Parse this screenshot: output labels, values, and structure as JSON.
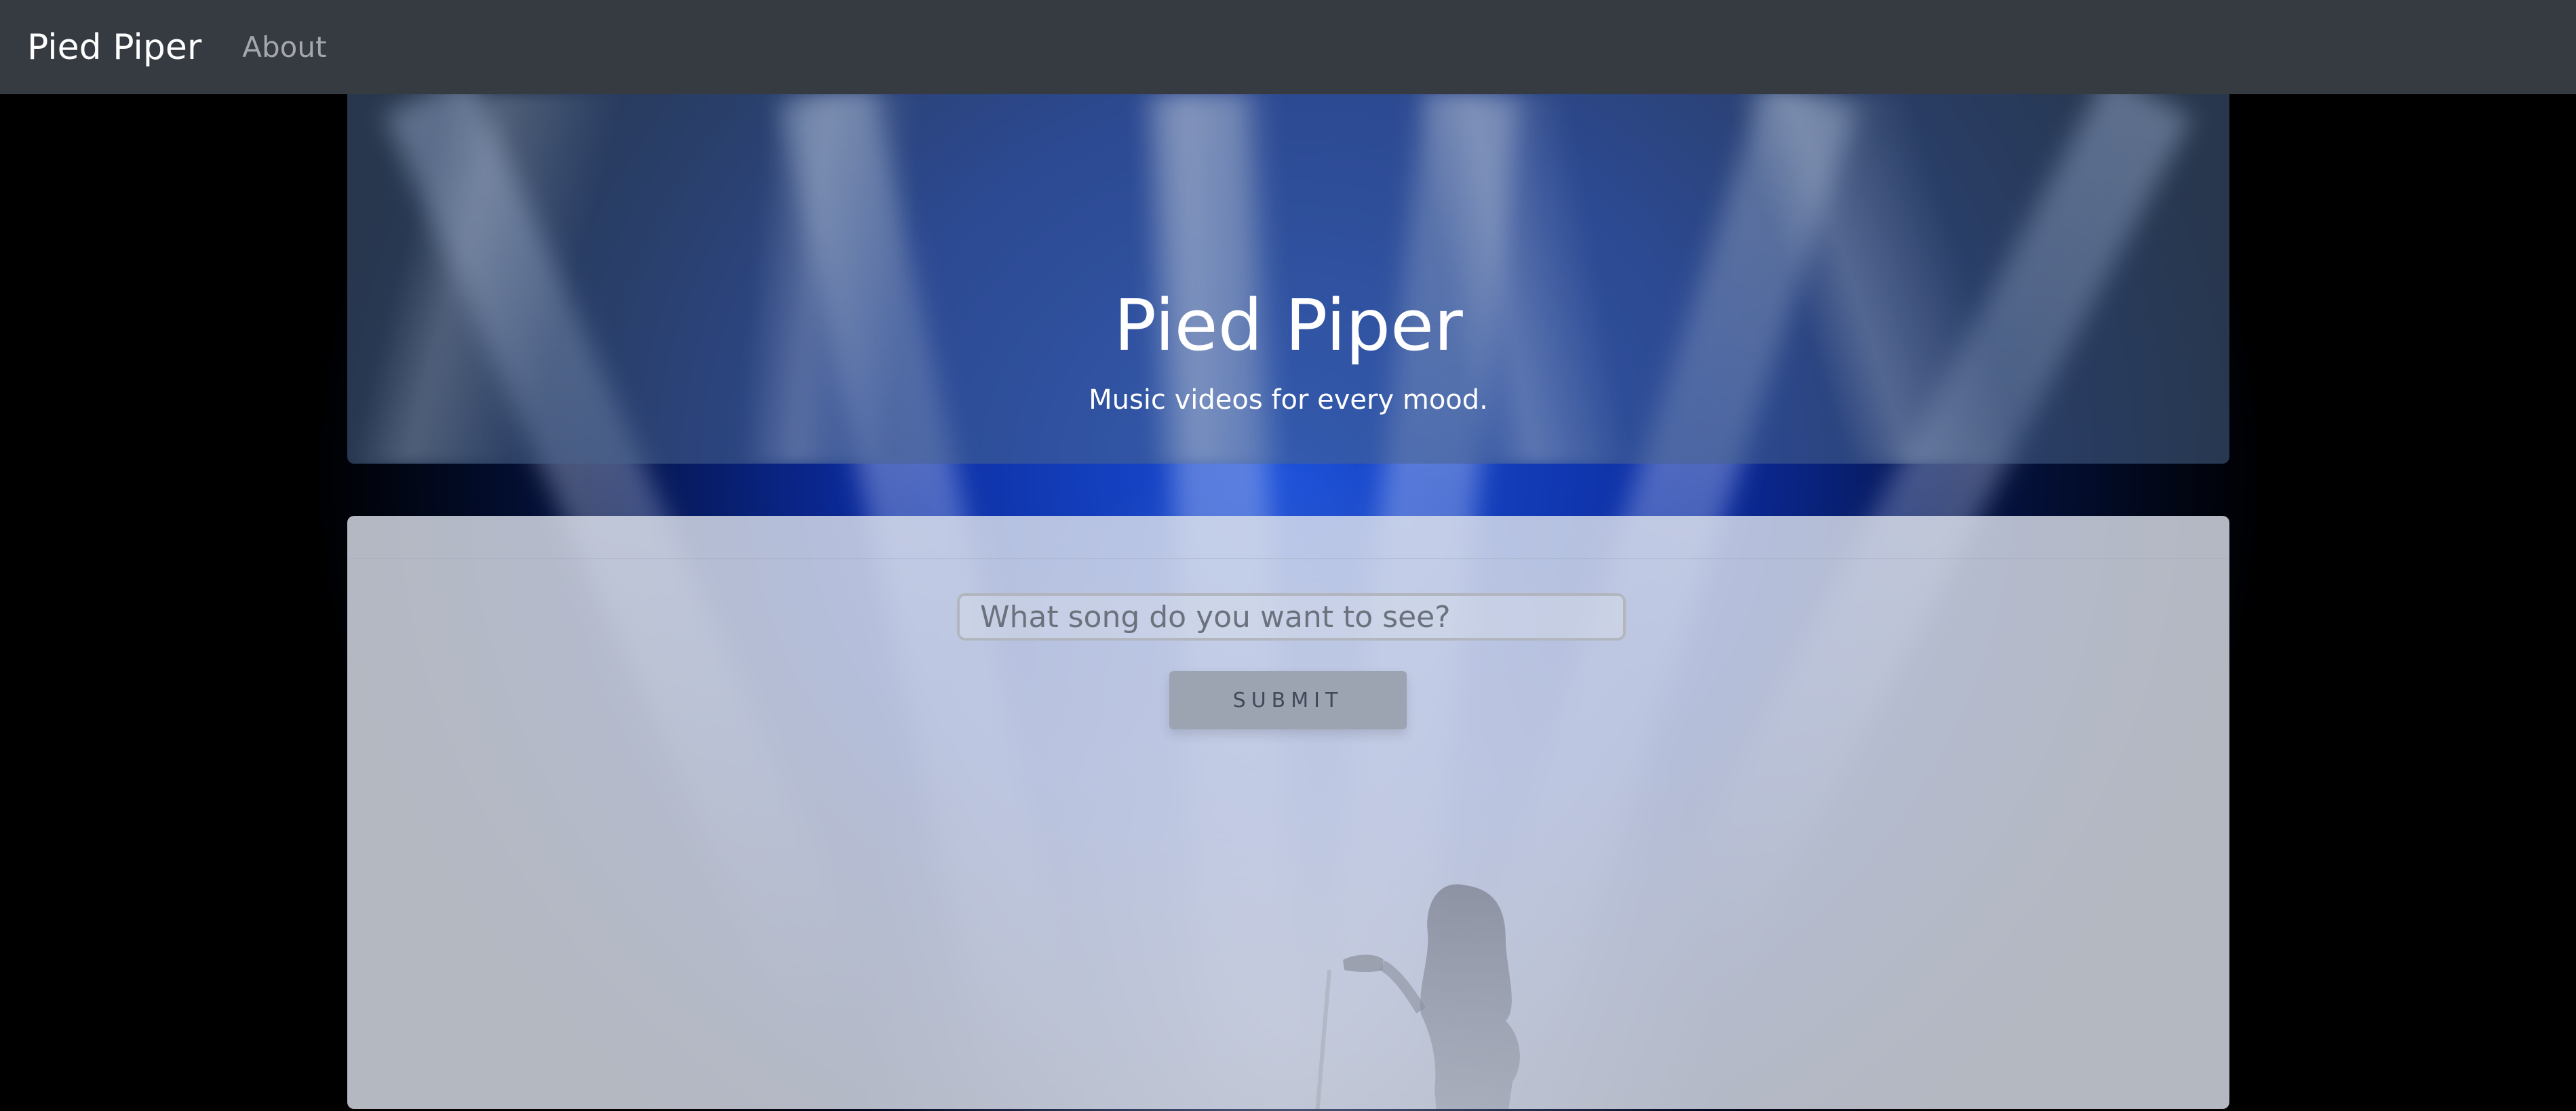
{
  "navbar": {
    "brand": "Pied Piper",
    "links": [
      {
        "label": "About"
      }
    ]
  },
  "hero": {
    "title": "Pied Piper",
    "subtitle": "Music videos for every mood."
  },
  "search": {
    "placeholder": "What song do you want to see?",
    "value": "",
    "submit_label": "SUBMIT"
  },
  "colors": {
    "navbar_bg": "#363a41",
    "stage_blue": "#1a4fd8",
    "button_bg": "#9ca3b1"
  }
}
